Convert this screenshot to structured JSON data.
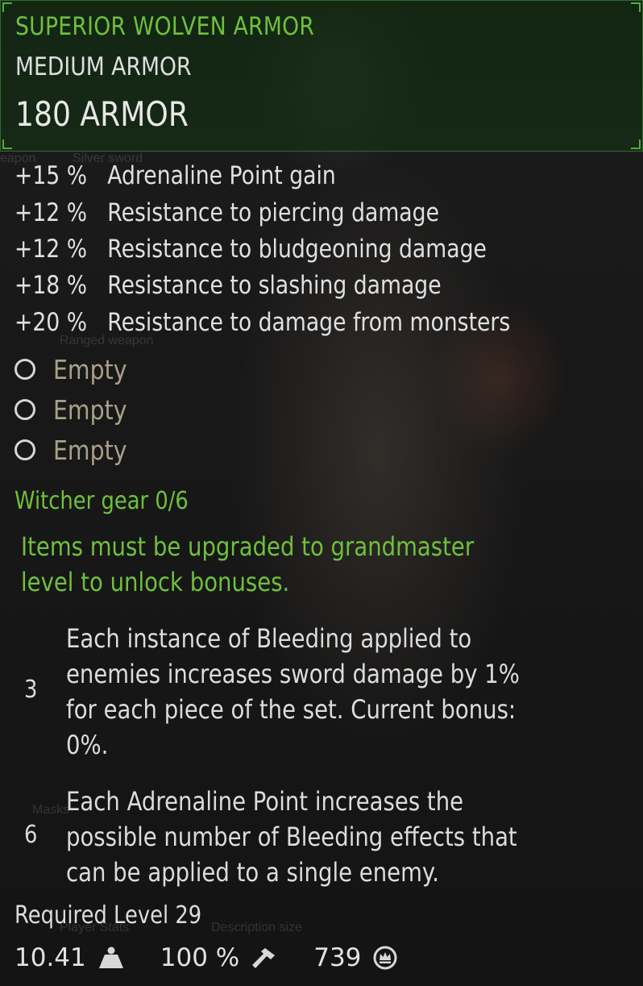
{
  "item": {
    "name": "SUPERIOR WOLVEN ARMOR",
    "type": "MEDIUM ARMOR",
    "armor": "180 ARMOR"
  },
  "stats": [
    {
      "value": "+15 %",
      "label": "Adrenaline Point gain"
    },
    {
      "value": "+12 %",
      "label": "Resistance to piercing damage"
    },
    {
      "value": "+12 %",
      "label": "Resistance to bludgeoning damage"
    },
    {
      "value": "+18 %",
      "label": "Resistance to slashing damage"
    },
    {
      "value": "+20 %",
      "label": "Resistance to damage from monsters"
    }
  ],
  "slots": [
    {
      "label": "Empty"
    },
    {
      "label": "Empty"
    },
    {
      "label": "Empty"
    }
  ],
  "set": {
    "title": "Witcher gear 0/6",
    "note_line1": "Items must be upgraded to grandmaster",
    "note_line2": "level to unlock bonuses.",
    "bonuses": [
      {
        "pieces": "3",
        "lines": [
          "Each instance of Bleeding applied to",
          "enemies increases sword damage by 1%",
          "for each piece of the set. Current bonus:",
          "0%."
        ]
      },
      {
        "pieces": "6",
        "lines": [
          "Each Adrenaline Point increases the",
          "possible number of Bleeding effects that",
          "can be applied to a single enemy."
        ]
      }
    ]
  },
  "required_level": "Required Level 29",
  "footer": {
    "weight": "10.41",
    "weight_icon": "weight-icon",
    "durability": "100 %",
    "durability_icon": "hammer-icon",
    "price": "739",
    "price_icon": "crowns-icon"
  },
  "background_text": {
    "weapon": "eapon",
    "silver_sword": "Silver sword",
    "ranged_weapon": "Ranged weapon",
    "masks": "Masks",
    "player_stats": "Player Stats",
    "description_size": "Description size"
  },
  "colors": {
    "accent_green": "#6fc03c",
    "header_border": "#2f6b2f",
    "text": "#dcdcdc",
    "empty_slot": "#a8a08a"
  }
}
